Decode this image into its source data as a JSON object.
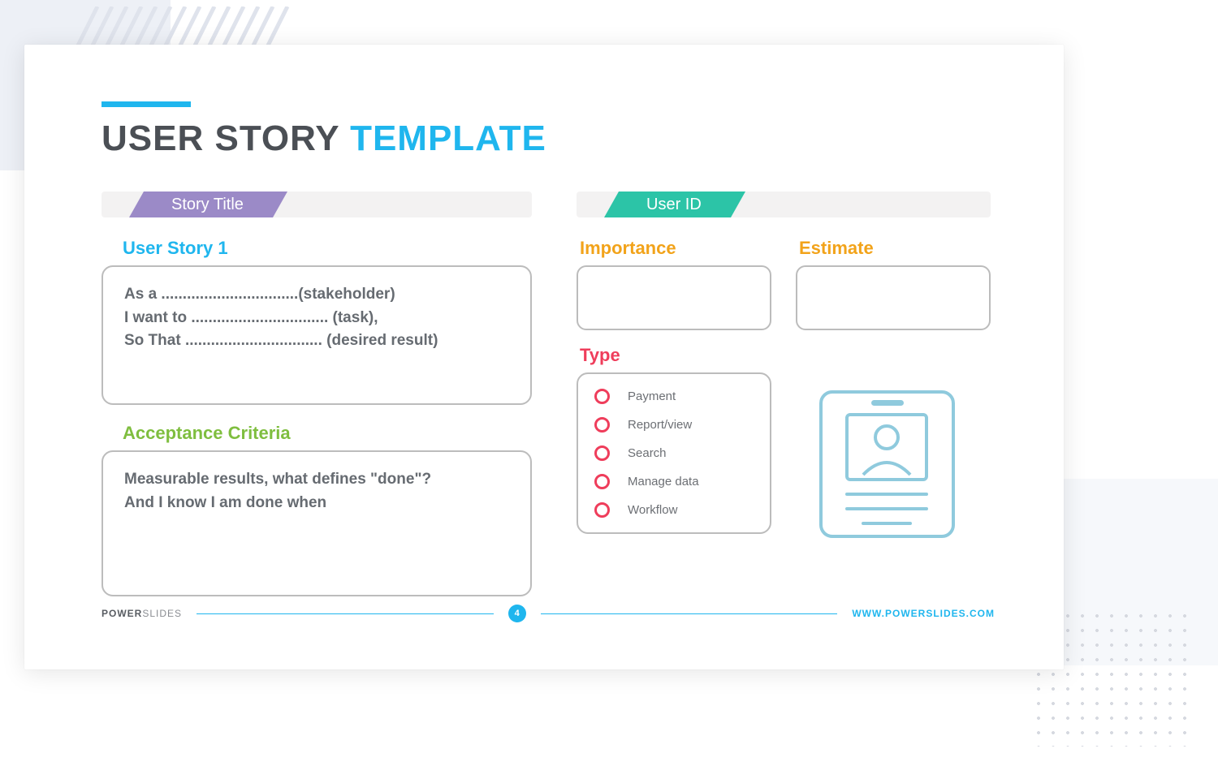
{
  "title": {
    "part1": "USER STORY",
    "part2": "TEMPLATE"
  },
  "tabs": {
    "story": "Story Title",
    "user": "User ID"
  },
  "labels": {
    "story": "User Story 1",
    "criteria": "Acceptance Criteria",
    "importance": "Importance",
    "estimate": "Estimate",
    "type": "Type"
  },
  "story_lines": {
    "l1": "As a ................................(stakeholder)",
    "l2": "I want to ................................ (task),",
    "l3": "So That ................................ (desired result)"
  },
  "criteria_lines": {
    "l1": "Measurable results, what defines \"done\"?",
    "l2": "And I know I am done  when"
  },
  "types": {
    "t1": "Payment",
    "t2": "Report/view",
    "t3": "Search",
    "t4": "Manage data",
    "t5": "Workflow"
  },
  "footer": {
    "brand1": "POWER",
    "brand2": "SLIDES",
    "page": "4",
    "site": "WWW.POWERSLIDES.COM"
  }
}
